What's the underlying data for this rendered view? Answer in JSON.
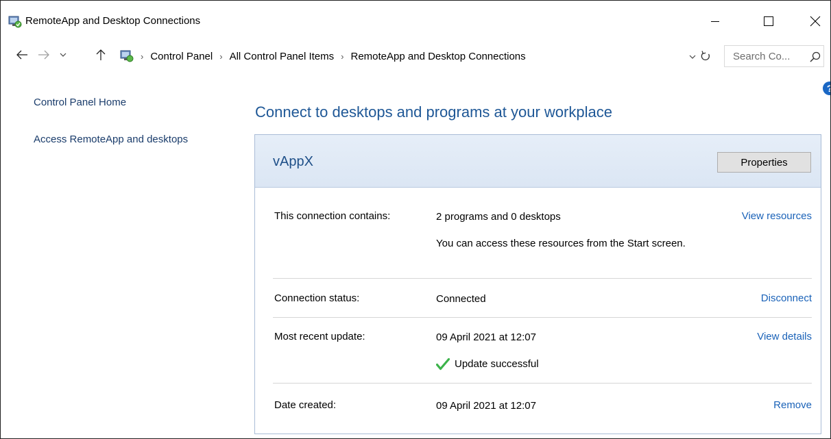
{
  "window": {
    "title": "RemoteApp and Desktop Connections"
  },
  "icons": {
    "app": "remoteapp-icon",
    "minimize": "minimize-icon",
    "maximize": "maximize-icon",
    "close": "close-icon",
    "back": "back-arrow-icon",
    "forward": "forward-arrow-icon",
    "recent": "chevron-down-icon",
    "up": "up-arrow-icon",
    "refresh": "refresh-icon",
    "search": "search-icon",
    "help": "help-icon",
    "check": "checkmark-icon"
  },
  "address": {
    "crumbs": [
      "Control Panel",
      "All Control Panel Items",
      "RemoteApp and Desktop Connections"
    ]
  },
  "search": {
    "placeholder": "Search Co..."
  },
  "sidebar": {
    "items": [
      {
        "label": "Control Panel Home"
      },
      {
        "label": "Access RemoteApp and desktops"
      }
    ]
  },
  "help": {
    "glyph": "?"
  },
  "main": {
    "heading": "Connect to desktops and programs at your workplace",
    "connection": {
      "name": "vAppX",
      "properties_label": "Properties",
      "rows": [
        {
          "label": "This connection contains:",
          "value": "2 programs and 0 desktops",
          "note": "You can access these resources from the Start screen.",
          "link": "View resources"
        },
        {
          "label": "Connection status:",
          "value": "Connected",
          "link": "Disconnect"
        },
        {
          "label": "Most recent update:",
          "value": "09 April 2021 at 12:07",
          "note": "Update successful",
          "link": "View details"
        },
        {
          "label": "Date created:",
          "value": "09 April 2021 at 12:07",
          "link": "Remove"
        }
      ]
    }
  },
  "colors": {
    "heading": "#1e5796",
    "link": "#1a62b8",
    "success": "#3cb34a"
  }
}
